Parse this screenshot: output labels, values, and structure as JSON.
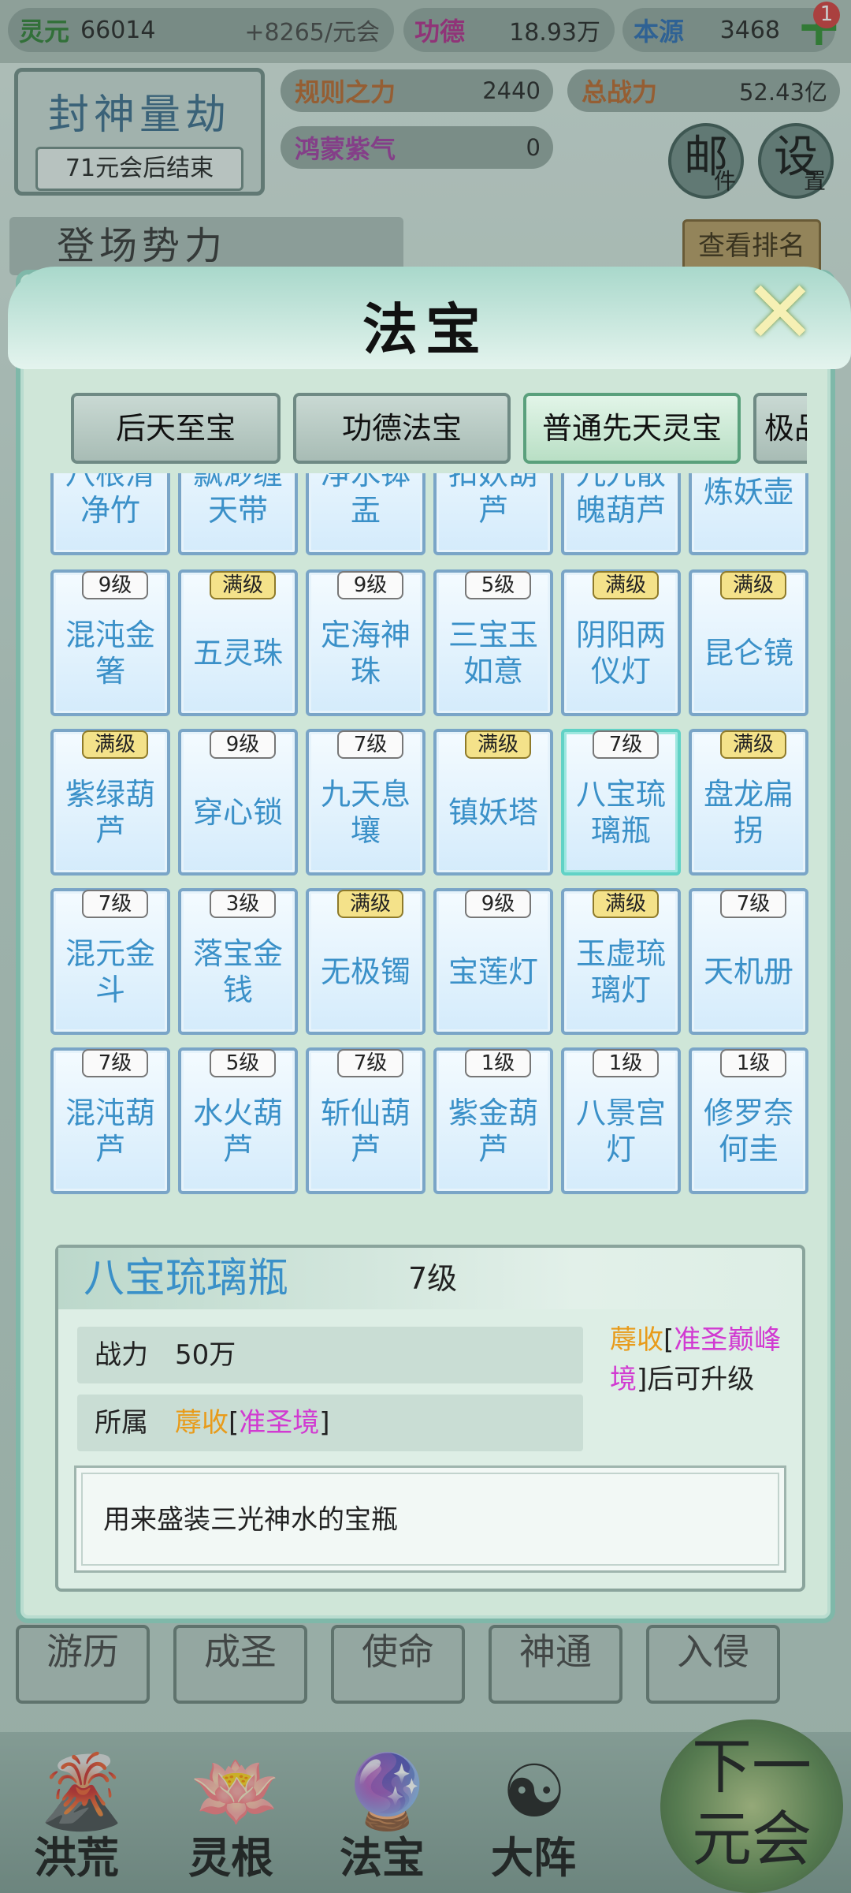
{
  "top": {
    "lingyuan_label": "灵元",
    "lingyuan_value": "66014",
    "rate": "+8265/元会",
    "gongde_label": "功德",
    "gongde_value": "18.93万",
    "benyuan_label": "本源",
    "benyuan_value": "3468",
    "badge": "1"
  },
  "event": {
    "title": "封神量劫",
    "subtitle": "71元会后结束"
  },
  "stats": {
    "guize_label": "规则之力",
    "guize_value": "2440",
    "zongzhanli_label": "总战力",
    "zongzhanli_value": "52.43亿",
    "hongmeng_label": "鸿蒙紫气",
    "hongmeng_value": "0"
  },
  "buttons": {
    "mail": "邮",
    "mail_small": "件",
    "settings": "设",
    "settings_small": "置",
    "rank": "查看排名"
  },
  "section_title": "登场势力",
  "bottom_row": [
    "游历",
    "成圣",
    "使命",
    "神通",
    "入侵"
  ],
  "nav": [
    {
      "label": "洪荒",
      "icon": "volcano-icon"
    },
    {
      "label": "灵根",
      "icon": "lotus-icon"
    },
    {
      "label": "法宝",
      "icon": "treasure-orb-icon"
    },
    {
      "label": "大阵",
      "icon": "yinyang-formation-icon"
    }
  ],
  "next_button": {
    "line1": "下一",
    "line2": "元会"
  },
  "modal": {
    "title": "法宝",
    "tabs": [
      "后天至宝",
      "功德法宝",
      "普通先天灵宝",
      "极品"
    ],
    "active_tab": 2,
    "partial_row": [
      "八根清净竹",
      "飘渺缠天带",
      "净水钵盂",
      "扣妖葫芦",
      "九九散魄葫芦",
      "炼妖壶"
    ],
    "items": [
      {
        "level": "9级",
        "name": "混沌金箸"
      },
      {
        "level": "满级",
        "name": "五灵珠"
      },
      {
        "level": "9级",
        "name": "定海神珠"
      },
      {
        "level": "5级",
        "name": "三宝玉如意"
      },
      {
        "level": "满级",
        "name": "阴阳两仪灯"
      },
      {
        "level": "满级",
        "name": "昆仑镜"
      },
      {
        "level": "满级",
        "name": "紫绿葫芦"
      },
      {
        "level": "9级",
        "name": "穿心锁"
      },
      {
        "level": "7级",
        "name": "九天息壤"
      },
      {
        "level": "满级",
        "name": "镇妖塔"
      },
      {
        "level": "7级",
        "name": "八宝琉璃瓶",
        "selected": true
      },
      {
        "level": "满级",
        "name": "盘龙扁拐"
      },
      {
        "level": "7级",
        "name": "混元金斗"
      },
      {
        "level": "3级",
        "name": "落宝金钱"
      },
      {
        "level": "满级",
        "name": "无极镯"
      },
      {
        "level": "9级",
        "name": "宝莲灯"
      },
      {
        "level": "满级",
        "name": "玉虚琉璃灯"
      },
      {
        "level": "7级",
        "name": "天机册"
      },
      {
        "level": "7级",
        "name": "混沌葫芦"
      },
      {
        "level": "5级",
        "name": "水火葫芦"
      },
      {
        "level": "7级",
        "name": "斩仙葫芦"
      },
      {
        "level": "1级",
        "name": "紫金葫芦"
      },
      {
        "level": "1级",
        "name": "八景宫灯"
      },
      {
        "level": "1级",
        "name": "修罗奈何圭"
      }
    ],
    "detail": {
      "name": "八宝琉璃瓶",
      "level": "7级",
      "power_label": "战力",
      "power_value": "50万",
      "owner_label": "所属",
      "owner_name": "蓐收",
      "owner_realm": "准圣境",
      "upgrade_who": "蓐收",
      "upgrade_realm": "准圣巅峰境",
      "upgrade_suffix": "]后可升级",
      "description": "用来盛装三光神水的宝瓶"
    }
  },
  "colors": {
    "name_blue": "#3a90c8",
    "orange": "#e89b1a",
    "pink": "#d13ad1",
    "gold_badge": "#f4e28a"
  }
}
